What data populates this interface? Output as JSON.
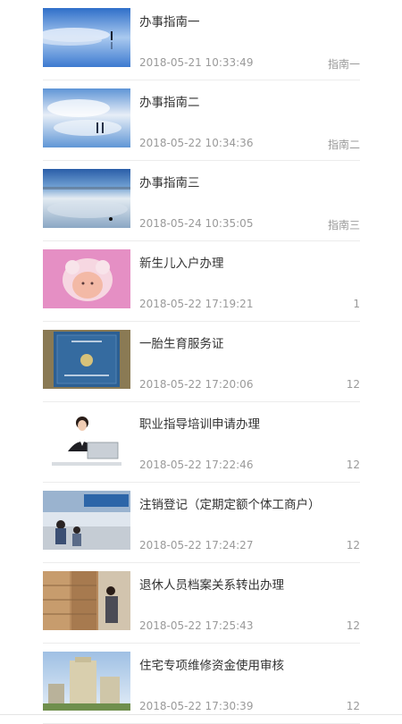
{
  "items": [
    {
      "title": "办事指南一",
      "date": "2018-05-21 10:33:49",
      "tag": "指南一",
      "image": "salt-flat-person-photo"
    },
    {
      "title": "办事指南二",
      "date": "2018-05-22 10:34:36",
      "tag": "指南二",
      "image": "salt-flat-couple-photo"
    },
    {
      "title": "办事指南三",
      "date": "2018-05-24 10:35:05",
      "tag": "指南三",
      "image": "salt-lake-photo"
    },
    {
      "title": "新生儿入户办理",
      "date": "2018-05-22 17:19:21",
      "tag": "1",
      "image": "baby-photo"
    },
    {
      "title": "一胎生育服务证",
      "date": "2018-05-22 17:20:06",
      "tag": "12",
      "image": "certificate-photo"
    },
    {
      "title": "职业指导培训申请办理",
      "date": "2018-05-22 17:22:46",
      "tag": "12",
      "image": "office-worker-photo"
    },
    {
      "title": "注销登记（定期定额个体工商户）",
      "date": "2018-05-22 17:24:27",
      "tag": "12",
      "image": "service-hall-photo"
    },
    {
      "title": "退休人员档案关系转出办理",
      "date": "2018-05-22 17:25:43",
      "tag": "12",
      "image": "archive-room-photo"
    },
    {
      "title": "住宅专项维修资金使用审核",
      "date": "2018-05-22 17:30:39",
      "tag": "12",
      "image": "building-photo"
    }
  ]
}
